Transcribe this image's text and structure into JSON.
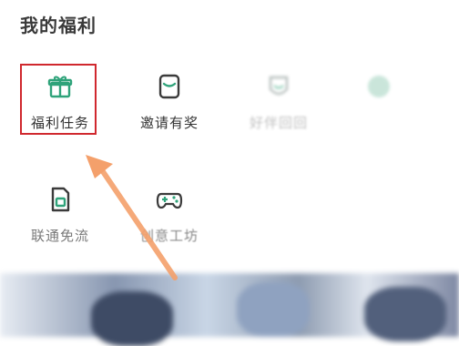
{
  "section": {
    "title": "我的福利"
  },
  "items": [
    {
      "label": "福利任务",
      "icon": "gift-icon"
    },
    {
      "label": "邀请有奖",
      "icon": "invite-card-icon"
    },
    {
      "label": "好伴回回",
      "icon": "smile-shield-icon"
    },
    {
      "label": "",
      "icon": "green-circle-icon"
    },
    {
      "label": "联通免流",
      "icon": "sim-card-icon"
    },
    {
      "label": "创意工坊",
      "icon": "gamepad-icon"
    }
  ],
  "colors": {
    "accent": "#2fa37a",
    "highlight_border": "#d0282e",
    "arrow": "#f4a06b"
  }
}
